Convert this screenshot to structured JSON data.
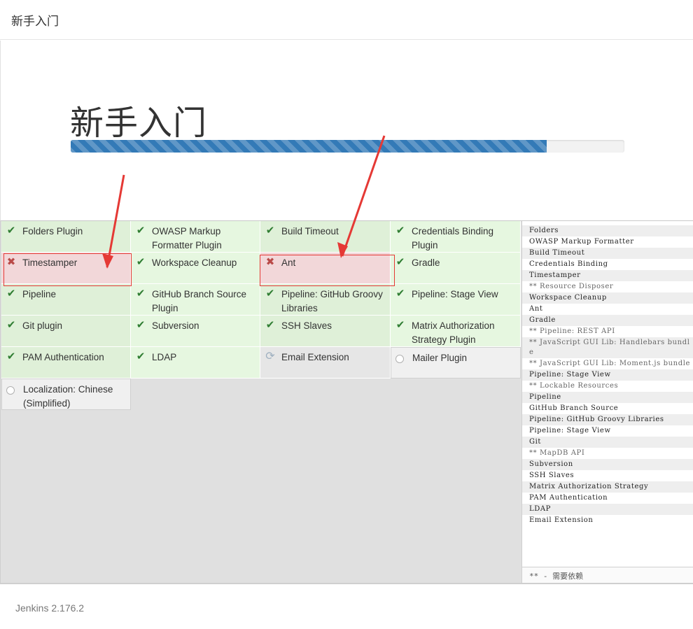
{
  "header": {
    "title": "新手入门"
  },
  "banner": {
    "title": "新手入门",
    "progress_percent": 86
  },
  "plugins": [
    {
      "name": "Folders Plugin",
      "status": "success"
    },
    {
      "name": "OWASP Markup Formatter Plugin",
      "status": "success"
    },
    {
      "name": "Build Timeout",
      "status": "success"
    },
    {
      "name": "Credentials Binding Plugin",
      "status": "success"
    },
    {
      "name": "Timestamper",
      "status": "fail"
    },
    {
      "name": "Workspace Cleanup",
      "status": "success"
    },
    {
      "name": "Ant",
      "status": "fail"
    },
    {
      "name": "Gradle",
      "status": "success"
    },
    {
      "name": "Pipeline",
      "status": "success"
    },
    {
      "name": "GitHub Branch Source Plugin",
      "status": "success"
    },
    {
      "name": "Pipeline: GitHub Groovy Libraries",
      "status": "success"
    },
    {
      "name": "Pipeline: Stage View",
      "status": "success"
    },
    {
      "name": "Git plugin",
      "status": "success"
    },
    {
      "name": "Subversion",
      "status": "success"
    },
    {
      "name": "SSH Slaves",
      "status": "success"
    },
    {
      "name": "Matrix Authorization Strategy Plugin",
      "status": "success"
    },
    {
      "name": "PAM Authentication",
      "status": "success"
    },
    {
      "name": "LDAP",
      "status": "success"
    },
    {
      "name": "Email Extension",
      "status": "installing"
    },
    {
      "name": "Mailer Plugin",
      "status": "waiting"
    },
    {
      "name": "Localization: Chinese (Simplified)",
      "status": "waiting"
    }
  ],
  "log": [
    "Folders",
    "OWASP Markup Formatter",
    "Build Timeout",
    "Credentials Binding",
    "Timestamper",
    "** Resource Disposer",
    "Workspace Cleanup",
    "Ant",
    "Gradle",
    "** Pipeline: REST API",
    "** JavaScript GUI Lib: Handlebars bundle",
    "** JavaScript GUI Lib: Moment.js bundle",
    "Pipeline: Stage View",
    "** Lockable Resources",
    "Pipeline",
    "GitHub Branch Source",
    "Pipeline: GitHub Groovy Libraries",
    "Pipeline: Stage View",
    "Git",
    "** MapDB API",
    "Subversion",
    "SSH Slaves",
    "Matrix Authorization Strategy",
    "PAM Authentication",
    "LDAP",
    "Email Extension"
  ],
  "log_footer": "** - 需要依赖",
  "footer": {
    "version": "Jenkins 2.176.2"
  },
  "colors": {
    "progress": "#337ab7",
    "success_bg": "#dff0d8",
    "fail_bg": "#f2d7d9",
    "annotation": "#e53935"
  }
}
